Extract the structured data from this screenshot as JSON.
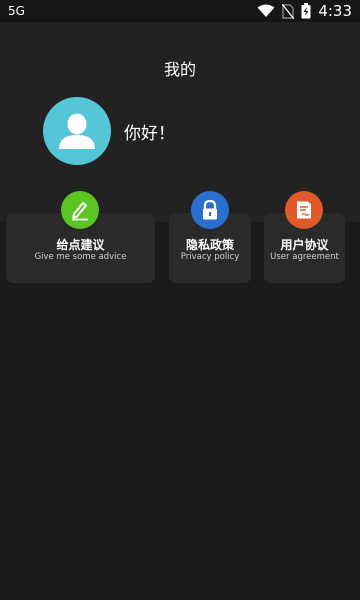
{
  "status_bar": {
    "network": "5G",
    "time": "4:33",
    "icons": [
      "wifi-icon",
      "no-sim-icon",
      "battery-charging-icon"
    ]
  },
  "profile": {
    "title": "我的",
    "greeting": "你好！",
    "avatar_icon": "user-icon"
  },
  "menu": [
    {
      "title": "给点建议",
      "subtitle": "Give me some advice",
      "icon": "pencil-icon",
      "color": "#5bc524"
    },
    {
      "title": "隐私政策",
      "subtitle": "Privacy policy",
      "icon": "lock-icon",
      "color": "#2a6fd0"
    },
    {
      "title": "用户协议",
      "subtitle": "User agreement",
      "icon": "document-icon",
      "color": "#e05a2c"
    }
  ],
  "colors": {
    "background": "#1a1a1b",
    "header": "#222223",
    "card": "#2a2a2b",
    "avatar": "#55c6d8"
  }
}
